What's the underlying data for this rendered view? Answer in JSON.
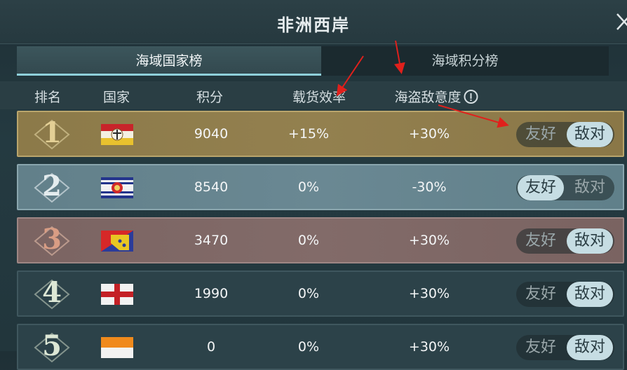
{
  "title": "非洲西岸",
  "tabs": [
    {
      "label": "海域国家榜",
      "active": true
    },
    {
      "label": "海域积分榜",
      "active": false
    }
  ],
  "columns": {
    "rank": "排名",
    "country": "国家",
    "score": "积分",
    "cargo": "载货效率",
    "pirate": "海盗敌意度"
  },
  "toggle_labels": {
    "friendly": "友好",
    "hostile": "敌对"
  },
  "rows": [
    {
      "rank": "1",
      "score": "9040",
      "cargo": "+15%",
      "pirate": "+30%",
      "stance": "hostile"
    },
    {
      "rank": "2",
      "score": "8540",
      "cargo": "0%",
      "pirate": "-30%",
      "stance": "friendly"
    },
    {
      "rank": "3",
      "score": "3470",
      "cargo": "0%",
      "pirate": "+30%",
      "stance": "hostile"
    },
    {
      "rank": "4",
      "score": "1990",
      "cargo": "0%",
      "pirate": "+30%",
      "stance": "hostile"
    },
    {
      "rank": "5",
      "score": "0",
      "cargo": "0%",
      "pirate": "+30%",
      "stance": "hostile"
    }
  ],
  "colors": {
    "annotation_arrow": "#e0201c",
    "toggle_on": "#c6dde3",
    "rank1_gold": "#d9c58a",
    "rank2_silver": "#dfe8ea",
    "rank3_bronze": "#d79c82",
    "rank_plain": "#dbe6d4"
  },
  "icons": {
    "close": "close-icon",
    "info": "info-icon"
  }
}
